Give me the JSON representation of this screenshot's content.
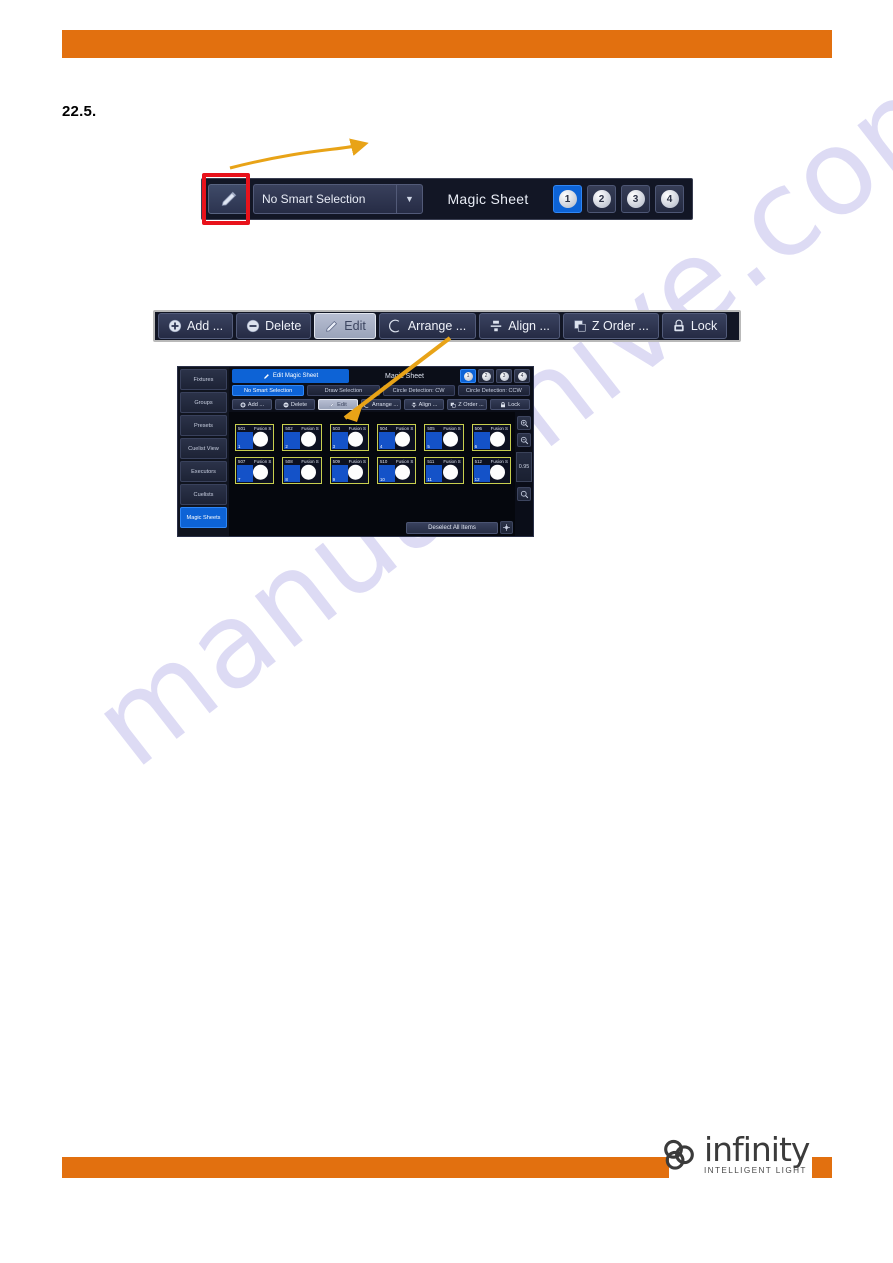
{
  "page": {
    "section_number": "22.5.",
    "watermark": "manualshive.com",
    "accent_orange": "#e2700f",
    "highlight_red": "#e8121b",
    "accent_blue": "#0d63d6"
  },
  "figure_toolbar": {
    "pencil_icon": "pencil-icon",
    "smart_selection_value": "No Smart Selection",
    "dropdown_caret": "chevron-down-icon",
    "title": "Magic Sheet",
    "pages": [
      {
        "label": "1",
        "active": true
      },
      {
        "label": "2",
        "active": false
      },
      {
        "label": "3",
        "active": false
      },
      {
        "label": "4",
        "active": false
      }
    ]
  },
  "figure_actions": {
    "buttons": [
      {
        "label": "Add ...",
        "icon": "plus-circle-icon",
        "pressed": false
      },
      {
        "label": "Delete",
        "icon": "minus-circle-icon",
        "pressed": false
      },
      {
        "label": "Edit",
        "icon": "pencil-icon",
        "pressed": true
      },
      {
        "label": "Arrange ...",
        "icon": "arc-icon",
        "pressed": false
      },
      {
        "label": "Align ...",
        "icon": "align-icon",
        "pressed": false
      },
      {
        "label": "Z Order ...",
        "icon": "layers-icon",
        "pressed": false
      },
      {
        "label": "Lock",
        "icon": "lock-icon",
        "pressed": false
      }
    ]
  },
  "console": {
    "sidebar": [
      {
        "label": "Fixtures",
        "active": false
      },
      {
        "label": "Groups",
        "active": false
      },
      {
        "label": "Presets",
        "active": false
      },
      {
        "label": "Cuelist View",
        "active": false
      },
      {
        "label": "Executors",
        "active": false
      },
      {
        "label": "Cuelists",
        "active": false
      },
      {
        "label": "Magic Sheets",
        "active": true
      }
    ],
    "edit_button_label": "Edit Magic Sheet",
    "title": "Magic Sheet",
    "pages": [
      {
        "label": "1",
        "active": true
      },
      {
        "label": "2",
        "active": false
      },
      {
        "label": "3",
        "active": false
      },
      {
        "label": "4",
        "active": false
      }
    ],
    "selection_tabs": [
      {
        "label": "No Smart Selection",
        "active": true
      },
      {
        "label": "Draw Selection",
        "active": false
      },
      {
        "label": "Circle Detection: CW",
        "active": false
      },
      {
        "label": "Circle Detection: CCW",
        "active": false
      }
    ],
    "action_buttons": [
      {
        "label": "Add ...",
        "icon": "plus-circle-icon",
        "pressed": false
      },
      {
        "label": "Delete",
        "icon": "minus-circle-icon",
        "pressed": false
      },
      {
        "label": "Edit",
        "icon": "pencil-icon",
        "pressed": true
      },
      {
        "label": "Arrange ...",
        "icon": "arc-icon",
        "pressed": false
      },
      {
        "label": "Align ...",
        "icon": "align-icon",
        "pressed": false
      },
      {
        "label": "Z Order ...",
        "icon": "layers-icon",
        "pressed": false
      },
      {
        "label": "Lock",
        "icon": "lock-icon",
        "pressed": false
      }
    ],
    "fixtures": [
      {
        "id": "501",
        "type": "Fusion S",
        "number": "1"
      },
      {
        "id": "502",
        "type": "Fusion S",
        "number": "2"
      },
      {
        "id": "503",
        "type": "Fusion S",
        "number": "3"
      },
      {
        "id": "504",
        "type": "Fusion S",
        "number": "4"
      },
      {
        "id": "505",
        "type": "Fusion S",
        "number": "5"
      },
      {
        "id": "506",
        "type": "Fusion S",
        "number": "6"
      },
      {
        "id": "507",
        "type": "Fusion S",
        "number": "7"
      },
      {
        "id": "508",
        "type": "Fusion S",
        "number": "8"
      },
      {
        "id": "509",
        "type": "Fusion S",
        "number": "9"
      },
      {
        "id": "510",
        "type": "Fusion S",
        "number": "10"
      },
      {
        "id": "511",
        "type": "Fusion S",
        "number": "11"
      },
      {
        "id": "512",
        "type": "Fusion S",
        "number": "12"
      }
    ],
    "zoom_level": "0.95",
    "zoom_in_icon": "zoom-in-icon",
    "zoom_out_icon": "zoom-out-icon",
    "zoom_fit_icon": "zoom-fit-icon",
    "center_icon": "center-align-icon",
    "deselect_label": "Deselect All Items"
  },
  "footer": {
    "logo_word": "infinity",
    "logo_tagline": "INTELLIGENT LIGHT"
  }
}
